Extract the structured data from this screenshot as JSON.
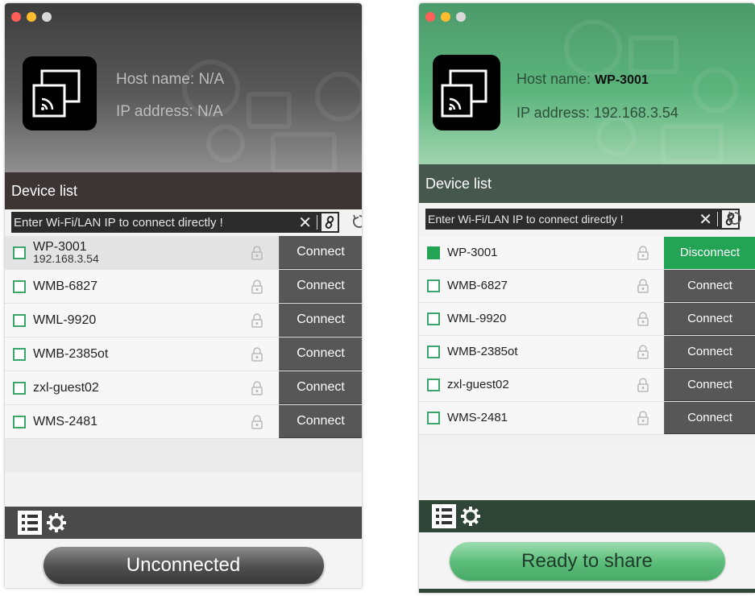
{
  "left": {
    "host_name_label": "Host name:",
    "host_name_value": "N/A",
    "ip_label": "IP address:",
    "ip_value": "N/A",
    "device_list_title": "Device list",
    "ip_placeholder": "Enter Wi-Fi/LAN IP to connect directly !",
    "devices": [
      {
        "name": "WP-3001",
        "ip": "192.168.3.54",
        "button": "Connect"
      },
      {
        "name": "WMB-6827",
        "button": "Connect"
      },
      {
        "name": "WML-9920",
        "button": "Connect"
      },
      {
        "name": "WMB-2385ot",
        "button": "Connect"
      },
      {
        "name": "zxl-guest02",
        "button": "Connect"
      },
      {
        "name": "WMS-2481",
        "button": "Connect"
      }
    ],
    "status_button": "Unconnected"
  },
  "right": {
    "host_name_label": "Host name:",
    "host_name_value": "WP-3001",
    "ip_label": "IP address:",
    "ip_value": "192.168.3.54",
    "device_list_title": "Device list",
    "ip_placeholder": "Enter Wi-Fi/LAN IP to connect directly !",
    "devices": [
      {
        "name": "WP-3001",
        "button": "Disconnect",
        "checked": true
      },
      {
        "name": "WMB-6827",
        "button": "Connect"
      },
      {
        "name": "WML-9920",
        "button": "Connect"
      },
      {
        "name": "WMB-2385ot",
        "button": "Connect"
      },
      {
        "name": "zxl-guest02",
        "button": "Connect"
      },
      {
        "name": "WMS-2481",
        "button": "Connect"
      }
    ],
    "status_button": "Ready to share"
  },
  "icons": {
    "clear": "close-icon",
    "link": "link-icon",
    "refresh": "refresh-icon",
    "lock": "lock-icon",
    "list": "list-icon",
    "settings": "gear-icon",
    "app": "screen-cast-icon"
  },
  "colors": {
    "accent_green": "#23a455",
    "connect_button": "#575757",
    "left_header": "#4a4a4a",
    "right_header": "#5cb57d"
  }
}
